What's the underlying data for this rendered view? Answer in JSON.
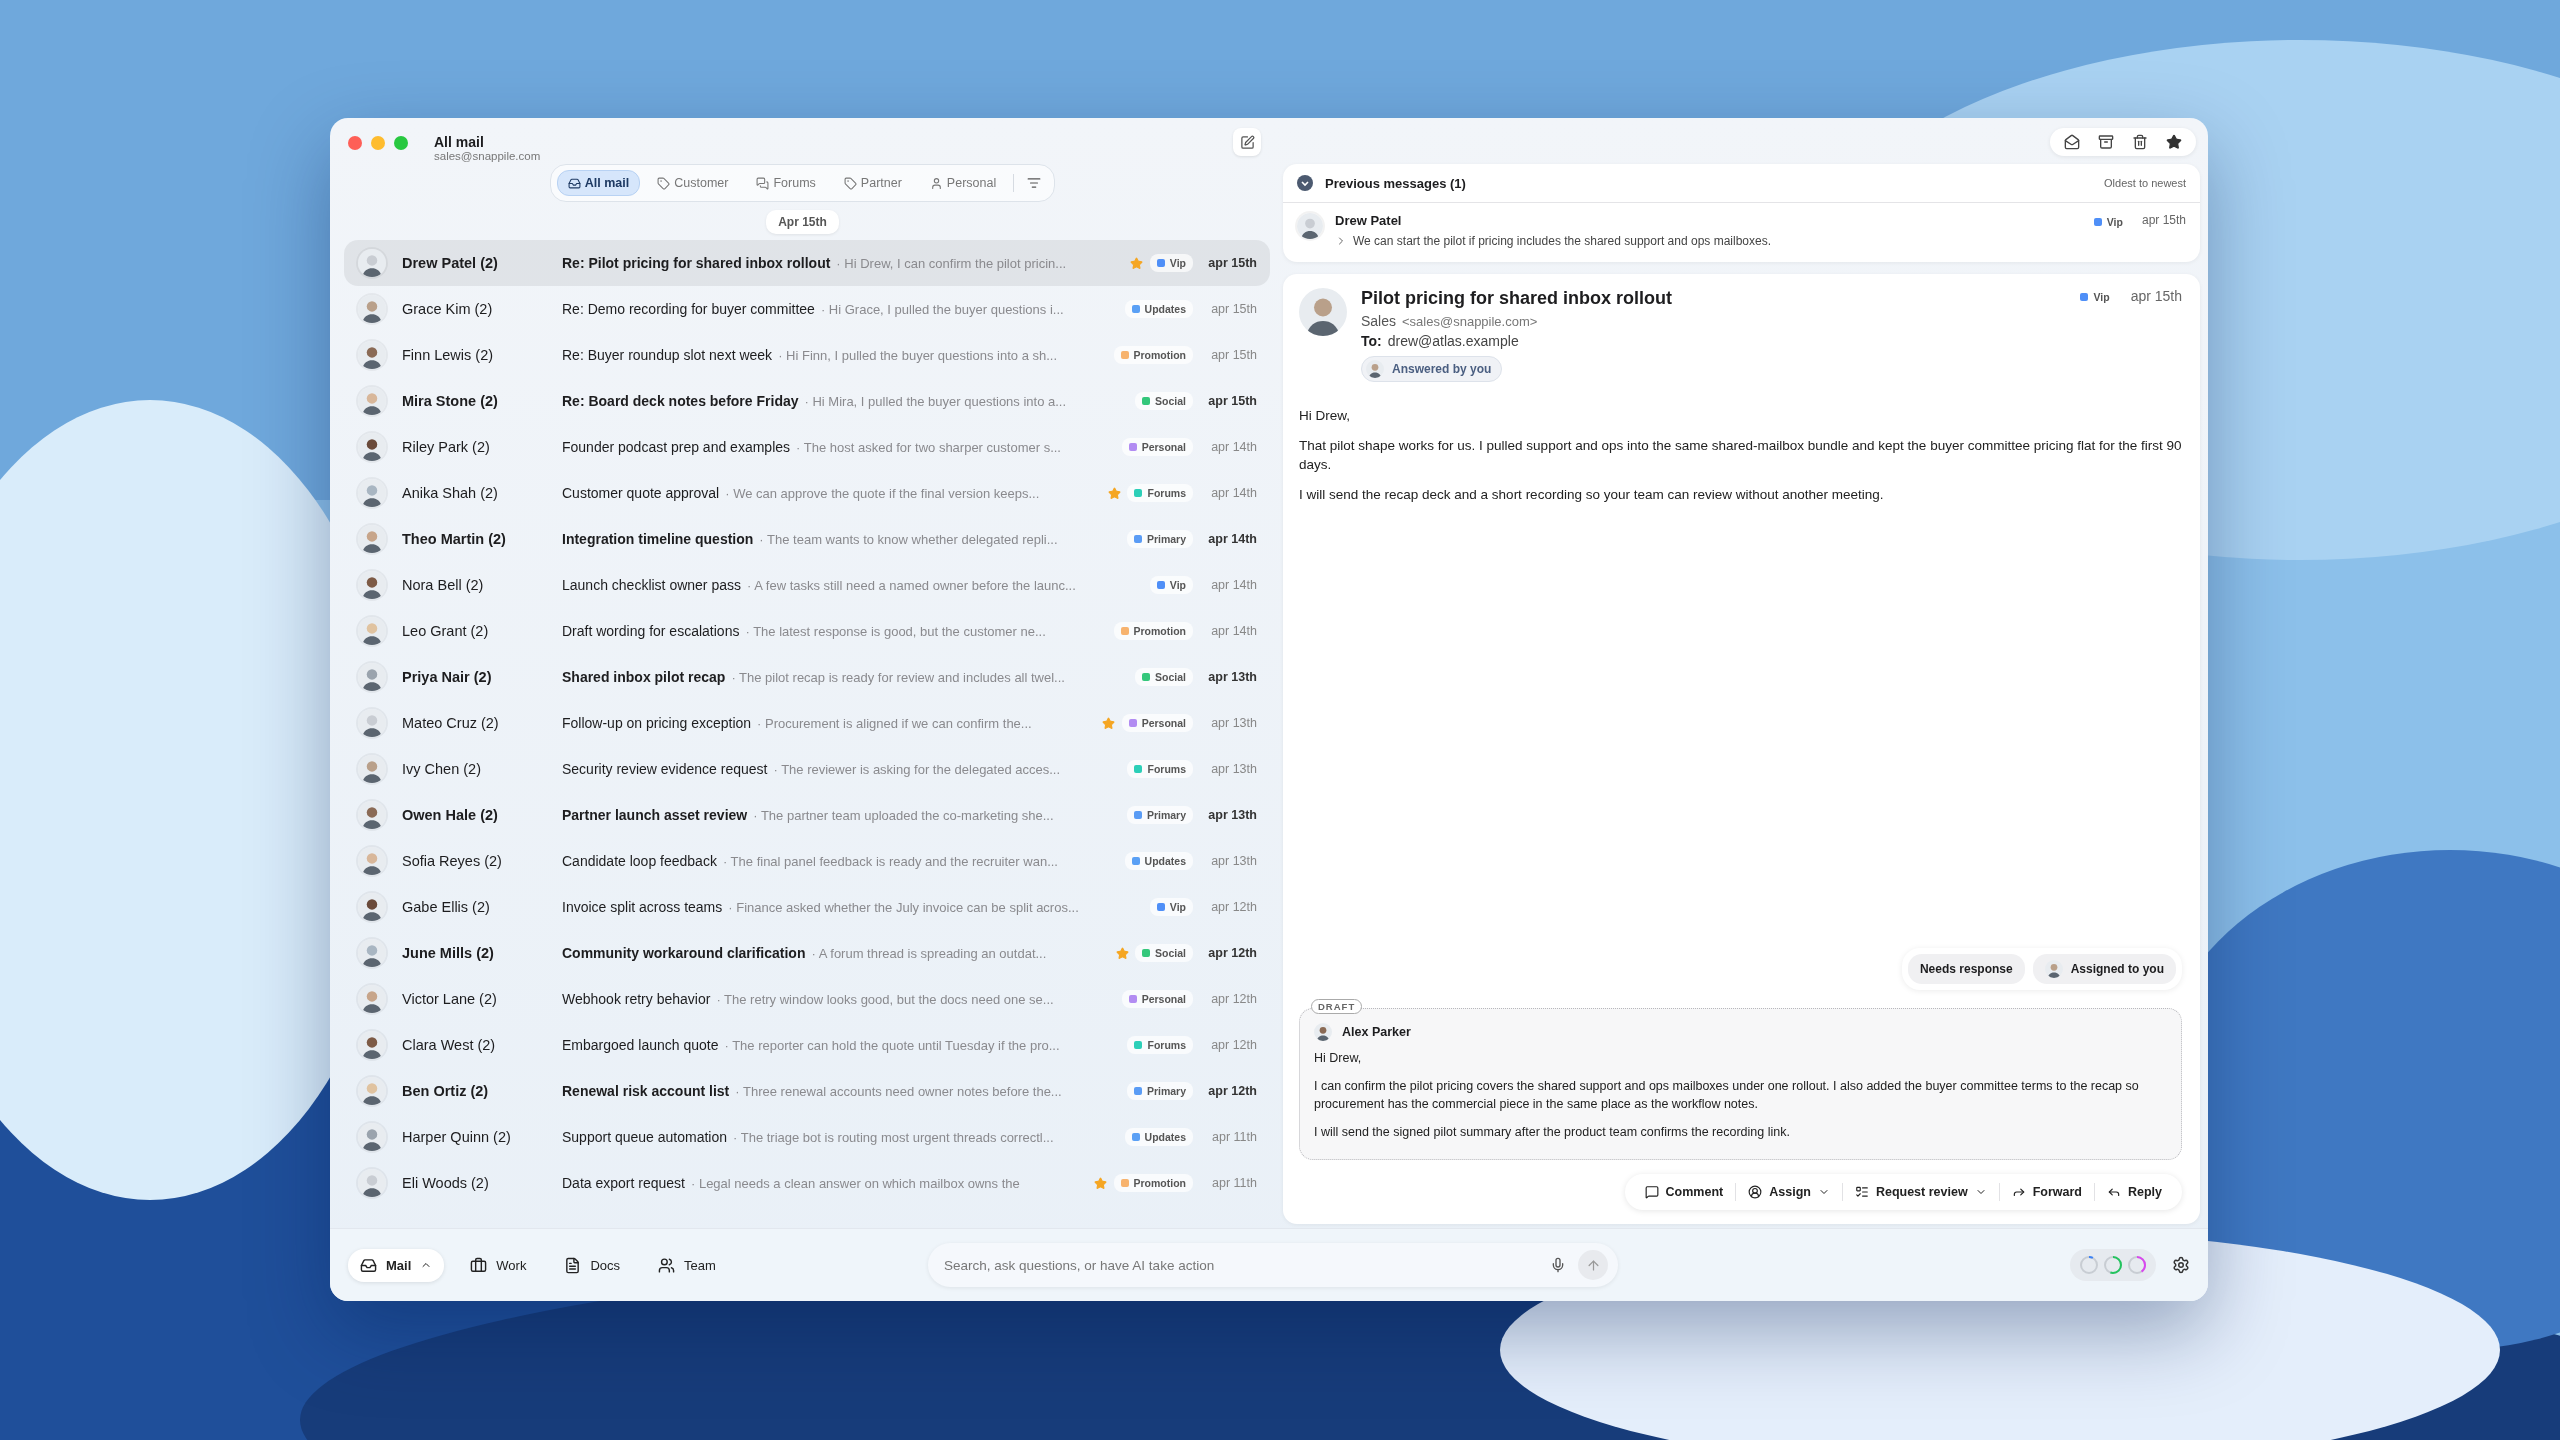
{
  "window": {
    "title": "All mail",
    "account": "sales@snappile.com"
  },
  "filters": [
    {
      "label": "All mail",
      "selected": true
    },
    {
      "label": "Customer",
      "selected": false
    },
    {
      "label": "Forums",
      "selected": false
    },
    {
      "label": "Partner",
      "selected": false
    },
    {
      "label": "Personal",
      "selected": false
    }
  ],
  "date_divider": "Apr 15th",
  "messages": [
    {
      "sender": "Drew Patel (2)",
      "subject": "Re: Pilot pricing for shared inbox rollout",
      "preview": "· Hi Drew, I can confirm the pilot pricin...",
      "starred": true,
      "tag": {
        "label": "Vip",
        "color": "#4f8ff7"
      },
      "date": "apr 15th",
      "unread": true,
      "selected": true
    },
    {
      "sender": "Grace Kim (2)",
      "subject": "Re: Demo recording for buyer committee",
      "preview": "· Hi Grace, I pulled the buyer questions i...",
      "starred": false,
      "tag": {
        "label": "Updates",
        "color": "#5aa0f5"
      },
      "date": "apr 15th",
      "unread": false,
      "selected": false
    },
    {
      "sender": "Finn Lewis (2)",
      "subject": "Re: Buyer roundup slot next week",
      "preview": "· Hi Finn, I pulled the buyer questions into a sh...",
      "starred": false,
      "tag": {
        "label": "Promotion",
        "color": "#f7b36e"
      },
      "date": "apr 15th",
      "unread": false,
      "selected": false
    },
    {
      "sender": "Mira Stone (2)",
      "subject": "Re: Board deck notes before Friday",
      "preview": "· Hi Mira, I pulled the buyer questions into a...",
      "starred": false,
      "tag": {
        "label": "Social",
        "color": "#34c77b"
      },
      "date": "apr 15th",
      "unread": true,
      "selected": false
    },
    {
      "sender": "Riley Park (2)",
      "subject": "Founder podcast prep and examples",
      "preview": "· The host asked for two sharper customer s...",
      "starred": false,
      "tag": {
        "label": "Personal",
        "color": "#b28cf2"
      },
      "date": "apr 14th",
      "unread": false,
      "selected": false
    },
    {
      "sender": "Anika Shah (2)",
      "subject": "Customer quote approval",
      "preview": "· We can approve the quote if the final version keeps...",
      "starred": true,
      "tag": {
        "label": "Forums",
        "color": "#2ccfb8"
      },
      "date": "apr 14th",
      "unread": false,
      "selected": false
    },
    {
      "sender": "Theo Martin (2)",
      "subject": "Integration timeline question",
      "preview": "· The team wants to know whether delegated repli...",
      "starred": false,
      "tag": {
        "label": "Primary",
        "color": "#5a9cf5"
      },
      "date": "apr 14th",
      "unread": true,
      "selected": false
    },
    {
      "sender": "Nora Bell (2)",
      "subject": "Launch checklist owner pass",
      "preview": "· A few tasks still need a named owner before the launc...",
      "starred": false,
      "tag": {
        "label": "Vip",
        "color": "#4f8ff7"
      },
      "date": "apr 14th",
      "unread": false,
      "selected": false
    },
    {
      "sender": "Leo Grant (2)",
      "subject": "Draft wording for escalations",
      "preview": "· The latest response is good, but the customer ne...",
      "starred": false,
      "tag": {
        "label": "Promotion",
        "color": "#f7b36e"
      },
      "date": "apr 14th",
      "unread": false,
      "selected": false
    },
    {
      "sender": "Priya Nair (2)",
      "subject": "Shared inbox pilot recap",
      "preview": "· The pilot recap is ready for review and includes all twel...",
      "starred": false,
      "tag": {
        "label": "Social",
        "color": "#34c77b"
      },
      "date": "apr 13th",
      "unread": true,
      "selected": false
    },
    {
      "sender": "Mateo Cruz (2)",
      "subject": "Follow-up on pricing exception",
      "preview": "· Procurement is aligned if we can confirm the...",
      "starred": true,
      "tag": {
        "label": "Personal",
        "color": "#b28cf2"
      },
      "date": "apr 13th",
      "unread": false,
      "selected": false
    },
    {
      "sender": "Ivy Chen (2)",
      "subject": "Security review evidence request",
      "preview": "· The reviewer is asking for the delegated acces...",
      "starred": false,
      "tag": {
        "label": "Forums",
        "color": "#2ccfb8"
      },
      "date": "apr 13th",
      "unread": false,
      "selected": false
    },
    {
      "sender": "Owen Hale (2)",
      "subject": "Partner launch asset review",
      "preview": "· The partner team uploaded the co-marketing she...",
      "starred": false,
      "tag": {
        "label": "Primary",
        "color": "#5a9cf5"
      },
      "date": "apr 13th",
      "unread": true,
      "selected": false
    },
    {
      "sender": "Sofia Reyes (2)",
      "subject": "Candidate loop feedback",
      "preview": "· The final panel feedback is ready and the recruiter wan...",
      "starred": false,
      "tag": {
        "label": "Updates",
        "color": "#5aa0f5"
      },
      "date": "apr 13th",
      "unread": false,
      "selected": false
    },
    {
      "sender": "Gabe Ellis (2)",
      "subject": "Invoice split across teams",
      "preview": "· Finance asked whether the July invoice can be split acros...",
      "starred": false,
      "tag": {
        "label": "Vip",
        "color": "#4f8ff7"
      },
      "date": "apr 12th",
      "unread": false,
      "selected": false
    },
    {
      "sender": "June Mills (2)",
      "subject": "Community workaround clarification",
      "preview": "· A forum thread is spreading an outdat...",
      "starred": true,
      "tag": {
        "label": "Social",
        "color": "#34c77b"
      },
      "date": "apr 12th",
      "unread": true,
      "selected": false
    },
    {
      "sender": "Victor Lane (2)",
      "subject": "Webhook retry behavior",
      "preview": "· The retry window looks good, but the docs need one se...",
      "starred": false,
      "tag": {
        "label": "Personal",
        "color": "#b28cf2"
      },
      "date": "apr 12th",
      "unread": false,
      "selected": false
    },
    {
      "sender": "Clara West (2)",
      "subject": "Embargoed launch quote",
      "preview": "· The reporter can hold the quote until Tuesday if the pro...",
      "starred": false,
      "tag": {
        "label": "Forums",
        "color": "#2ccfb8"
      },
      "date": "apr 12th",
      "unread": false,
      "selected": false
    },
    {
      "sender": "Ben Ortiz (2)",
      "subject": "Renewal risk account list",
      "preview": "· Three renewal accounts need owner notes before the...",
      "starred": false,
      "tag": {
        "label": "Primary",
        "color": "#5a9cf5"
      },
      "date": "apr 12th",
      "unread": true,
      "selected": false
    },
    {
      "sender": "Harper Quinn (2)",
      "subject": "Support queue automation",
      "preview": "· The triage bot is routing most urgent threads correctl...",
      "starred": false,
      "tag": {
        "label": "Updates",
        "color": "#5aa0f5"
      },
      "date": "apr 11th",
      "unread": false,
      "selected": false
    },
    {
      "sender": "Eli Woods (2)",
      "subject": "Data export request",
      "preview": "· Legal needs a clean answer on which mailbox owns the",
      "starred": true,
      "tag": {
        "label": "Promotion",
        "color": "#f7b36e"
      },
      "date": "apr 11th",
      "unread": false,
      "selected": false
    }
  ],
  "previous": {
    "title": "Previous messages (1)",
    "sort": "Oldest to newest",
    "items": [
      {
        "sender": "Drew Patel",
        "snippet": "We can start the pilot if pricing includes the shared support and ops mailboxes.",
        "tag": {
          "label": "Vip",
          "color": "#4f8ff7"
        },
        "date": "apr 15th"
      }
    ]
  },
  "message": {
    "subject": "Pilot pricing for shared inbox rollout",
    "from_name": "Sales",
    "from_address": "<sales@snappile.com>",
    "to_label": "To:",
    "to": "drew@atlas.example",
    "status": "Answered by you",
    "tag": {
      "label": "Vip",
      "color": "#4f8ff7"
    },
    "date": "apr 15th",
    "body": [
      "Hi Drew,",
      "That pilot shape works for us. I pulled support and ops into the same shared-mailbox bundle and kept the buyer committee pricing flat for the first 90 days.",
      "I will send the recap deck and a short recording so your team can review without another meeting."
    ]
  },
  "chips": [
    {
      "label": "Needs response",
      "kind": "plain"
    },
    {
      "label": "Assigned to you",
      "kind": "person"
    }
  ],
  "draft": {
    "label": "DRAFT",
    "author": "Alex Parker",
    "body": [
      "Hi Drew,",
      "I can confirm the pilot pricing covers the shared support and ops mailboxes under one rollout. I also added the buyer committee terms to the recap so procurement has the commercial piece in the same place as the workflow notes.",
      "I will send the signed pilot summary after the product team confirms the recording link."
    ]
  },
  "actions": [
    {
      "label": "Comment",
      "dropdown": false
    },
    {
      "label": "Assign",
      "dropdown": true
    },
    {
      "label": "Request review",
      "dropdown": true
    },
    {
      "label": "Forward",
      "dropdown": false
    },
    {
      "label": "Reply",
      "dropdown": false
    }
  ],
  "bottom_nav": [
    {
      "label": "Mail",
      "selected": true
    },
    {
      "label": "Work",
      "selected": false
    },
    {
      "label": "Docs",
      "selected": false
    },
    {
      "label": "Team",
      "selected": false
    }
  ],
  "search": {
    "placeholder": "Search, ask questions, or have AI take action"
  }
}
